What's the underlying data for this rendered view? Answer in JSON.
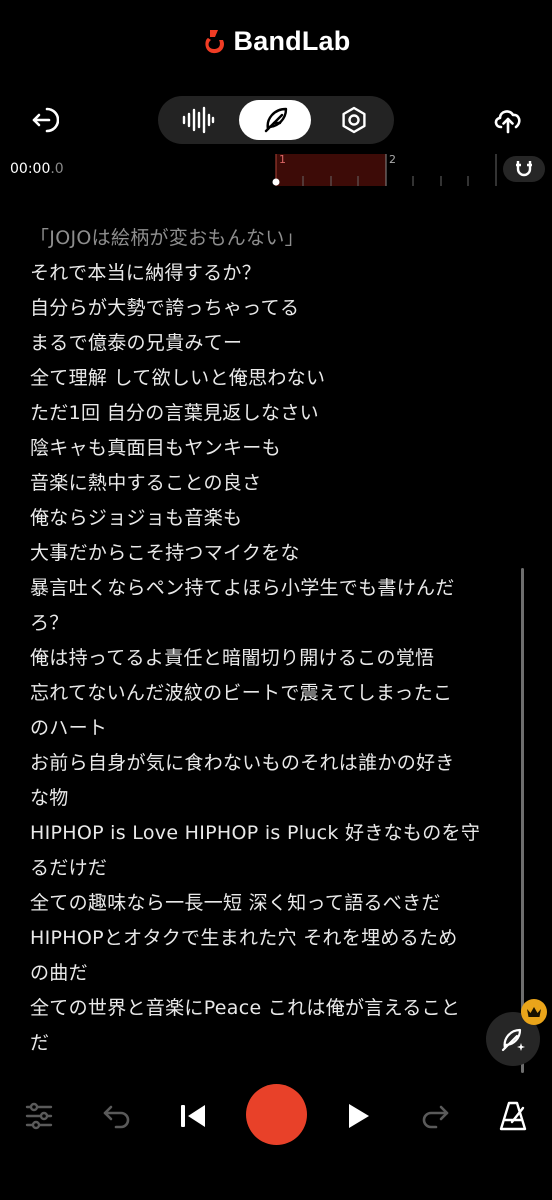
{
  "app": {
    "brand_name": "BandLab",
    "brand_color": "#f03c24"
  },
  "toolbar": {
    "exit_icon": "exit-icon",
    "modes": [
      {
        "name": "waveform",
        "icon": "waveform-icon"
      },
      {
        "name": "lyrics",
        "icon": "feather-icon",
        "active": true
      },
      {
        "name": "settings",
        "icon": "hexagon-settings-icon"
      }
    ],
    "upload_icon": "cloud-upload-icon"
  },
  "timeline": {
    "time_main": "00:00",
    "time_fraction": ".0",
    "bar_1_label": "1",
    "bar_2_label": "2",
    "loop_region_color": "#3d0b07",
    "snap_icon": "magnet-icon"
  },
  "lyrics": [
    "「JOJOは絵柄が変おもんない」",
    "それで本当に納得するか？",
    "自分らが大勢で誇っちゃってる",
    "まるで億泰の兄貴みてー",
    "全て理解 して欲しいと俺思わない",
    "ただ1回 自分の言葉見返しなさい",
    "陰キャも真面目もヤンキーも",
    "音楽に熱中することの良さ",
    "俺ならジョジョも音楽も",
    "大事だからこそ持つマイクをな",
    "暴言吐くならペン持てよほら小学生でも書けんだ",
    "ろ？",
    "俺は持ってるよ責任と暗闇切り開けるこの覚悟",
    "忘れてないんだ波紋のビートで震えてしまったこ",
    "のハート",
    "お前ら自身が気に食わないものそれは誰かの好き",
    "な物",
    "HIPHOP is Love  HIPHOP is Pluck 好きなものを守",
    "るだけだ",
    "全ての趣味なら一長一短 深く知って語るべきだ",
    "HIPHOPとオタクで生まれた穴 それを埋めるため",
    "の曲だ",
    "全ての世界と音楽にPeace これは俺が言えること",
    "だ"
  ],
  "floating": {
    "ai_icon": "ai-write-icon",
    "badge_icon": "crown-icon",
    "badge_color": "#e9a41a"
  },
  "transport": {
    "mixer_icon": "mixer-sliders-icon",
    "undo_icon": "undo-icon",
    "rewind_icon": "skip-to-start-icon",
    "record_icon": "record-icon",
    "record_color": "#e84129",
    "play_icon": "play-icon",
    "redo_icon": "redo-icon",
    "metronome_icon": "metronome-icon"
  }
}
